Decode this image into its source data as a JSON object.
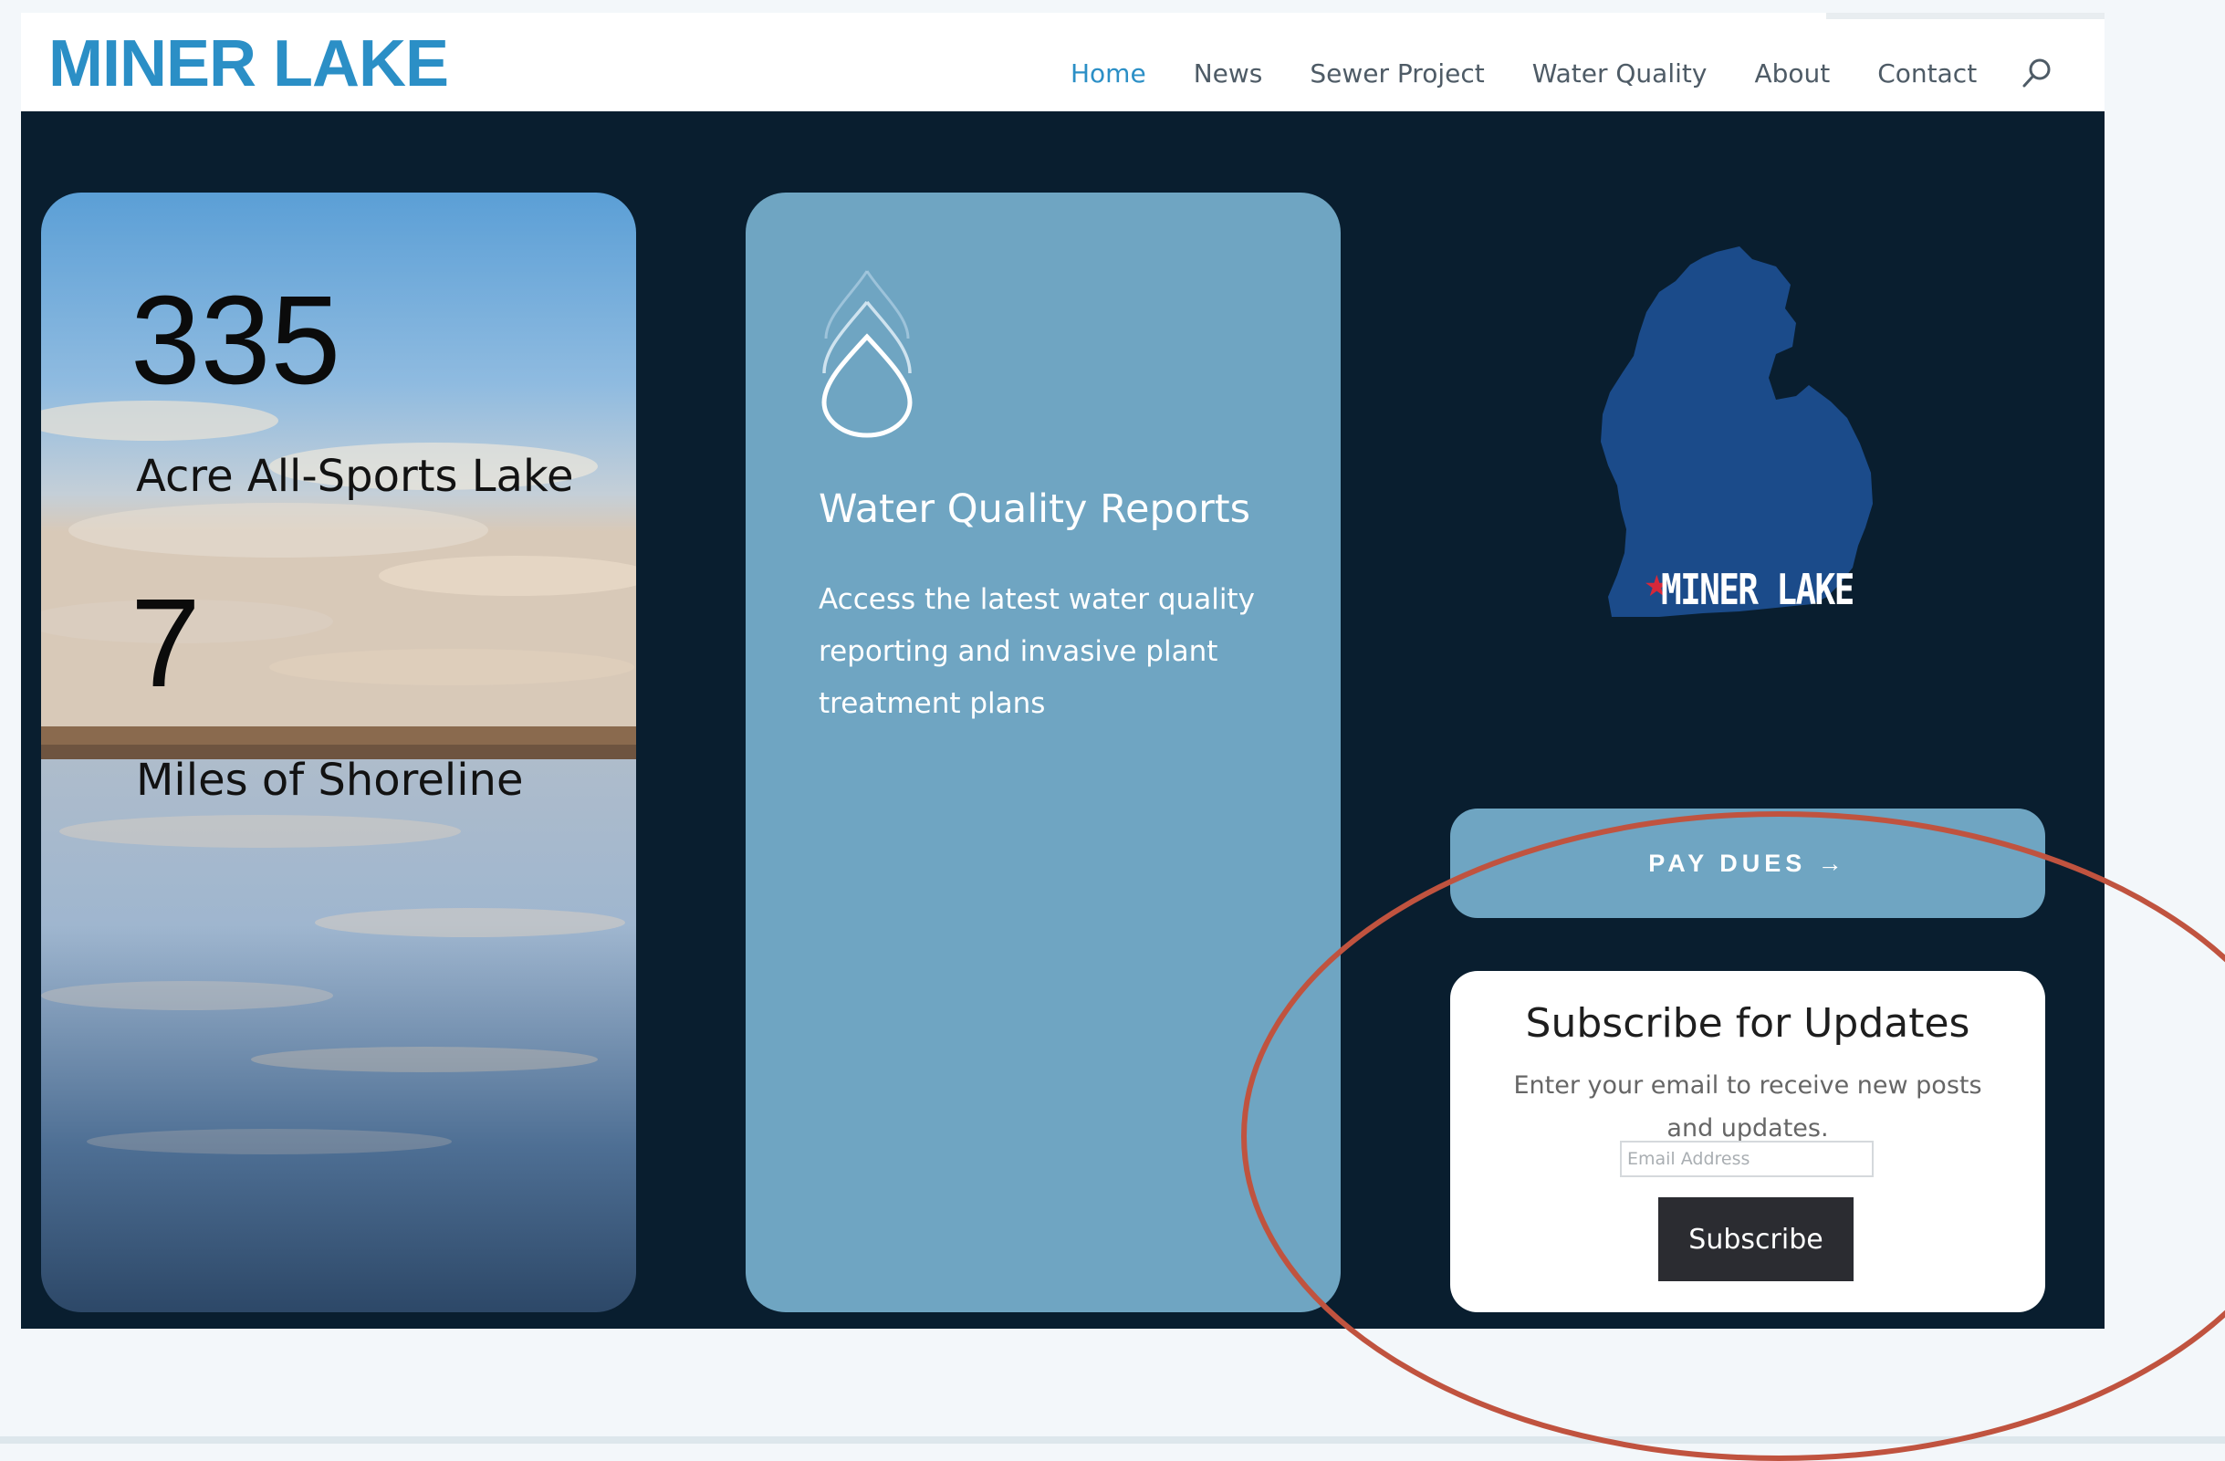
{
  "header": {
    "logo": "MINER LAKE",
    "nav": [
      "Home",
      "News",
      "Sewer Project",
      "Water Quality",
      "About",
      "Contact"
    ],
    "active_nav": "Home",
    "search_icon": "search-icon"
  },
  "stats_card": {
    "stat1_value": "335",
    "stat1_label": "Acre All-Sports Lake",
    "stat2_value": "7",
    "stat2_label": "Miles of Shoreline"
  },
  "water_card": {
    "icon": "water-drop-icon",
    "title": "Water Quality Reports",
    "description": "Access the latest water quality reporting and invasive plant treatment plans"
  },
  "map": {
    "label": "MINER LAKE",
    "marker_icon": "star-icon"
  },
  "pay_dues": {
    "label": "PAY DUES →"
  },
  "subscribe": {
    "title": "Subscribe for Updates",
    "description": "Enter your email to receive new posts and updates.",
    "email_placeholder": "Email Address",
    "button_label": "Subscribe"
  },
  "colors": {
    "brand": "#2b8fc6",
    "page_bg": "#091e2f",
    "card_blue": "#6fa5c2",
    "map_blue": "#1b4b8a",
    "annotation": "#c0533f"
  }
}
